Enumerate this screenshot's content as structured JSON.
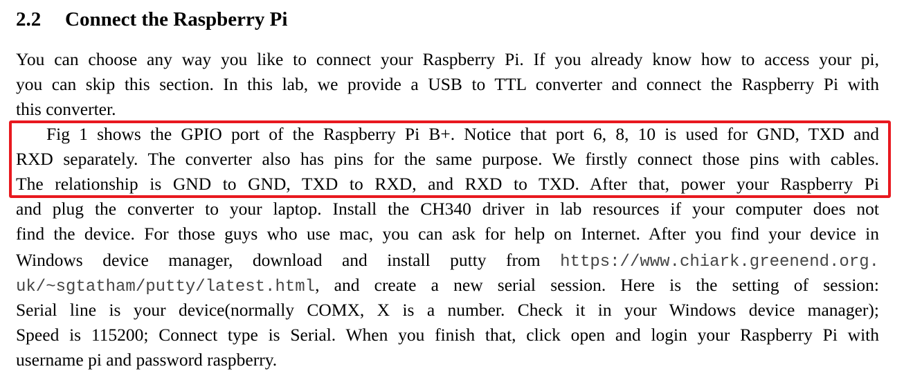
{
  "section": {
    "number": "2.2",
    "title": "Connect the Raspberry Pi"
  },
  "paragraph1": {
    "lines": [
      "You can choose any way you like to connect your Raspberry Pi. If you already know how to access your pi,",
      "you can skip this section. In this lab, we provide a USB to TTL converter and connect the Raspberry Pi with",
      "this converter."
    ]
  },
  "paragraph2": {
    "highlight_color": "#e8191f",
    "lines": [
      "Fig 1 shows the GPIO port of the Raspberry Pi B+. Notice that port 6, 8, 10 is used for GND, TXD and",
      "RXD separately. The converter also has pins for the same purpose. We firstly connect those pins with cables.",
      "The relationship is GND to GND, TXD to RXD, and RXD to TXD. After that, power your Raspberry Pi",
      "and plug the converter to your laptop. Install the CH340 driver in lab resources if your computer does not",
      "find the device. For those guys who use mac, you can ask for help on Internet. After you find your device in"
    ],
    "line8_text": "Windows device manager, download and install putty from",
    "url_part1": "https://www.chiark.greenend.org.",
    "url_part2": "uk/~sgtatham/putty/latest.html",
    "line9_text": ", and create a new serial session. Here is the setting of session:",
    "lines_after": [
      "Serial line is your device(normally COMX, X is a number.  Check it in your Windows device manager);",
      "Speed is 115200; Connect type is Serial. When you finish that, click open and login your Raspberry Pi with",
      "username pi and password raspberry."
    ]
  }
}
